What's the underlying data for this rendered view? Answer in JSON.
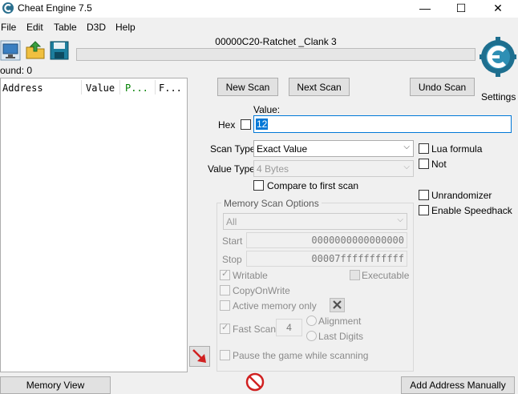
{
  "window": {
    "title": "Cheat Engine 7.5",
    "minimize": "—",
    "maximize": "☐",
    "close": "✕"
  },
  "menu": [
    "File",
    "Edit",
    "Table",
    "D3D",
    "Help"
  ],
  "process_title": "00000C20-Ratchet _Clank 3",
  "found_label": "ound: 0",
  "list_columns": [
    "Address",
    "Value",
    "P...",
    "F..."
  ],
  "buttons": {
    "new_scan": "New Scan",
    "next_scan": "Next Scan",
    "undo_scan": "Undo Scan",
    "settings": "Settings"
  },
  "value_label": "Value:",
  "hex_label": "Hex",
  "value_input": "12",
  "scan_type": {
    "label": "Scan Type",
    "selected": "Exact Value"
  },
  "value_type": {
    "label": "Value Type",
    "selected": "4 Bytes"
  },
  "compare_first": "Compare to first scan",
  "right_options": {
    "lua_formula": "Lua formula",
    "not": "Not",
    "unrandomizer": "Unrandomizer",
    "enable_speedhack": "Enable Speedhack"
  },
  "memory_scan": {
    "title": "Memory Scan Options",
    "region": "All",
    "start_label": "Start",
    "start_value": "0000000000000000",
    "stop_label": "Stop",
    "stop_value": "00007fffffffffff",
    "writable": "Writable",
    "executable": "Executable",
    "copy_on_write": "CopyOnWrite",
    "active_memory_only": "Active memory only",
    "fast_scan": "Fast Scan",
    "fast_scan_value": "4",
    "alignment": "Alignment",
    "last_digits": "Last Digits",
    "pause_game": "Pause the game while scanning"
  },
  "bottom": {
    "memory_view": "Memory View",
    "add_address": "Add Address Manually"
  },
  "colors": {
    "accent": "#0078d7",
    "green_column": "#008000",
    "arrow_red": "#d02020"
  }
}
